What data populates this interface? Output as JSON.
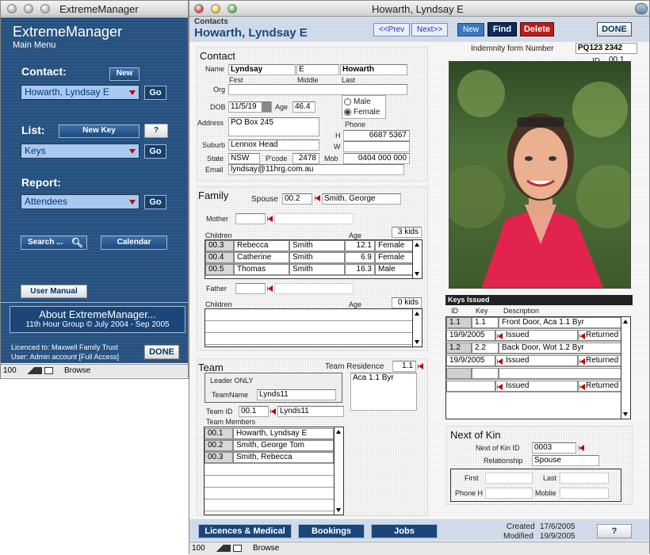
{
  "left_window": {
    "title": "ExtremeManager",
    "app_name": "ExtremeManager",
    "subtitle": "Main Menu",
    "contact_label": "Contact:",
    "new_label": "New",
    "contact_value": "Howarth, Lyndsay E",
    "go_label": "Go",
    "list_label": "List:",
    "new_key_label": "New Key",
    "help_label": "?",
    "list_value": "Keys",
    "report_label": "Report:",
    "report_value": "Attendees",
    "search_label": "Search ...",
    "calendar_label": "Calendar",
    "manual_label": "User Manual",
    "about_title": "About ExtremeManager...",
    "about_sub": "11th Hour Group © July 2004 - Sep 2005",
    "licence": "Licenced to: Maxwell Family Trust",
    "user": "User:  Admin account [Full Access]",
    "done_label": "DONE",
    "zoom": "100",
    "mode": "Browse"
  },
  "right_window": {
    "title": "Howarth, Lyndsay E",
    "layout_name": "Contacts",
    "record_name": "Howarth, Lyndsay E",
    "prev_label": "<<Prev",
    "next_label": "Next>>",
    "new_label": "New",
    "find_label": "Find",
    "delete_label": "Delete",
    "done_label": "DONE",
    "zoom": "100",
    "mode": "Browse"
  },
  "contact": {
    "section_title": "Contact",
    "name_label": "Name",
    "first": "Lyndsay",
    "middle": "E",
    "last": "Howarth",
    "first_cap": "First",
    "middle_cap": "Middle",
    "last_cap": "Last",
    "org_label": "Org",
    "org": "",
    "dob_label": "DOB",
    "dob": "11/5/19",
    "age_label": "Age",
    "age": "46.4",
    "male_label": "Male",
    "female_label": "Female",
    "gender": "Female",
    "address_label": "Address",
    "address": "PO Box 245",
    "phone_label": "Phone",
    "h_label": "H",
    "phone_h": "6687 5367",
    "w_label": "W",
    "phone_w": "",
    "suburb_label": "Suburb",
    "suburb": "Lennox Head",
    "state_label": "State",
    "state": "NSW",
    "pcode_label": "P'code",
    "pcode": "2478",
    "mob_label": "Mob",
    "mob": "0404 000 000",
    "email_label": "Email",
    "email": "lyndsay@11hrg.com.au"
  },
  "indemnity": {
    "label": "Indemnity form Number",
    "value": "PQ123 2342",
    "id_label": "ID",
    "id": "00.1"
  },
  "family": {
    "section_title": "Family",
    "spouse_label": "Spouse",
    "spouse_id": "00.2",
    "spouse_name": "Smith, George",
    "mother_label": "Mother",
    "children_label": "Children",
    "age_label": "Age",
    "kids_count": "3 kids",
    "children": [
      {
        "id": "00.3",
        "first": "Rebecca",
        "last": "Smith",
        "age": "12.1",
        "sex": "Female"
      },
      {
        "id": "00.4",
        "first": "Catherine",
        "last": "Smith",
        "age": "6.9",
        "sex": "Female"
      },
      {
        "id": "00.5",
        "first": "Thomas",
        "last": "Smith",
        "age": "16.3",
        "sex": "Male"
      }
    ],
    "father_label": "Father",
    "father_children_label": "Children",
    "father_age_label": "Age",
    "father_kids_count": "0 kids"
  },
  "team": {
    "section_title": "Team",
    "residence_label": "Team Residence",
    "residence_id": "1.1",
    "residence_name": "Aca 1.1 Byr",
    "leader_only": "Leader ONLY",
    "teamname_label": "TeamName",
    "teamname": "Lynds11",
    "teamid_label": "Team ID",
    "team_id": "00.1",
    "team_id_name": "Lynds11",
    "members_label": "Team Members",
    "members": [
      {
        "id": "00.1",
        "name": "Howarth, Lyndsay E"
      },
      {
        "id": "00.2",
        "name": "Smith, George Tom"
      },
      {
        "id": "00.3",
        "name": "Smith, Rebecca"
      }
    ]
  },
  "keys": {
    "section_title": "Keys Issued",
    "id_col": "ID",
    "key_col": "Key",
    "desc_col": "Description",
    "items": [
      {
        "id": "1.1",
        "key": "1.1",
        "desc": "Front Door, Aca 1.1 Byr",
        "date": "19/9/2005",
        "issued": "Issued",
        "returned": "Returned"
      },
      {
        "id": "1.2",
        "key": "2.2",
        "desc": "Back Door, Wot 1.2 Byr",
        "date": "19/9/2005",
        "issued": "Issued",
        "returned": "Returned"
      },
      {
        "id": "",
        "key": "",
        "desc": "",
        "date": "",
        "issued": "Issued",
        "returned": "Returned"
      }
    ]
  },
  "kin": {
    "section_title": "Next of Kin",
    "id_label": "Next of Kin ID",
    "id": "0003",
    "rel_label": "Relationship",
    "relationship": "Spouse",
    "first_label": "First",
    "last_label": "Last",
    "phone_label": "Phone H",
    "mobile_label": "Moblie"
  },
  "footer": {
    "licences_label": "Licences & Medical",
    "bookings_label": "Bookings",
    "jobs_label": "Jobs",
    "created_label": "Created",
    "created": "17/6/2005",
    "modified_label": "Modified",
    "modified": "19/9/2005",
    "help_label": "?"
  },
  "colors": {
    "menu_blue": "#26507e",
    "header_blue": "#1d4a7c",
    "delete_red": "#b81e1e",
    "find_navy": "#0f2a5c"
  }
}
